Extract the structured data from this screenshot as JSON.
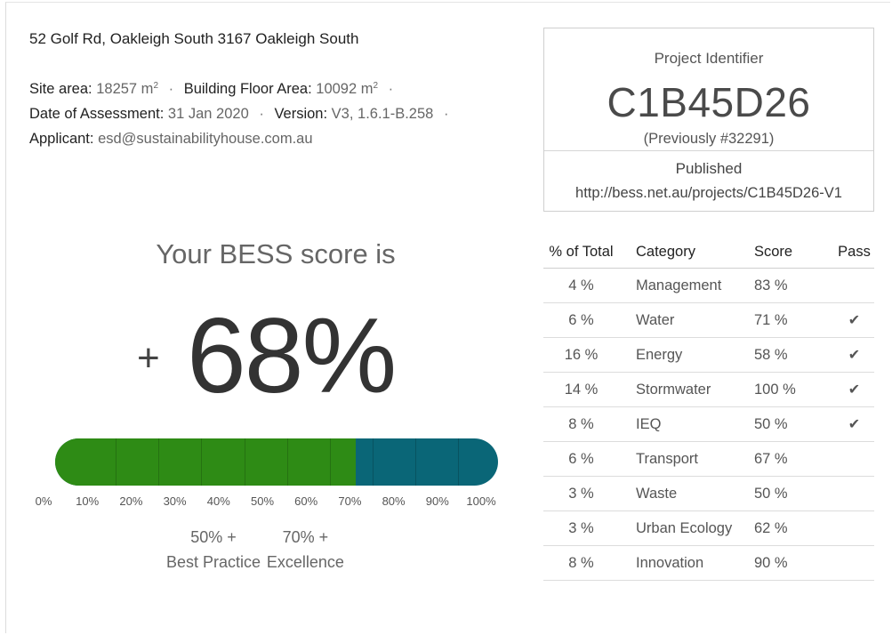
{
  "header": {
    "address": "52 Golf Rd, Oakleigh South 3167 Oakleigh South",
    "site_area_label": "Site area:",
    "site_area_value": "18257 m",
    "building_floor_area_label": "Building Floor Area:",
    "building_floor_area_value": "10092 m",
    "area_unit_sup": "2",
    "date_label": "Date of Assessment:",
    "date_value": "31 Jan 2020",
    "version_label": "Version:",
    "version_value": "V3, 1.6.1-B.258",
    "applicant_label": "Applicant:",
    "applicant_value": "esd@sustainabilityhouse.com.au",
    "separator": "·"
  },
  "project": {
    "identifier_label": "Project Identifier",
    "identifier": "C1B45D26",
    "previous": "(Previously #32291)",
    "status": "Published",
    "url": "http://bess.net.au/projects/C1B45D26-V1"
  },
  "score": {
    "title": "Your BESS score is",
    "sign": "+",
    "value": "68%",
    "fill_percent": 68,
    "colors": {
      "achieved": "#2e8b15",
      "remaining": "#0a6677"
    },
    "ticks": [
      "0%",
      "10%",
      "20%",
      "30%",
      "40%",
      "50%",
      "60%",
      "70%",
      "80%",
      "90%",
      "100%"
    ],
    "thresholds": [
      {
        "pct": "50% +",
        "label": "Best Practice",
        "at": 50
      },
      {
        "pct": "70% +",
        "label": "Excellence",
        "at": 70
      }
    ]
  },
  "categories": {
    "headers": {
      "pct": "% of Total",
      "category": "Category",
      "score": "Score",
      "pass": "Pass"
    },
    "rows": [
      {
        "pct": "4 %",
        "category": "Management",
        "score": "83 %",
        "pass": "",
        "status": "good"
      },
      {
        "pct": "6 %",
        "category": "Water",
        "score": "71 %",
        "pass": "✔",
        "status": "good"
      },
      {
        "pct": "16 %",
        "category": "Energy",
        "score": "58 %",
        "pass": "✔",
        "status": "good"
      },
      {
        "pct": "14 %",
        "category": "Stormwater",
        "score": "100 %",
        "pass": "✔",
        "status": "good"
      },
      {
        "pct": "8 %",
        "category": "IEQ",
        "score": "50 %",
        "pass": "✔",
        "status": "mid"
      },
      {
        "pct": "6 %",
        "category": "Transport",
        "score": "67 %",
        "pass": "",
        "status": "good"
      },
      {
        "pct": "3 %",
        "category": "Waste",
        "score": "50 %",
        "pass": "",
        "status": "mid"
      },
      {
        "pct": "3 %",
        "category": "Urban Ecology",
        "score": "62 %",
        "pass": "",
        "status": "good"
      },
      {
        "pct": "8 %",
        "category": "Innovation",
        "score": "90 %",
        "pass": "",
        "status": "good"
      }
    ]
  }
}
